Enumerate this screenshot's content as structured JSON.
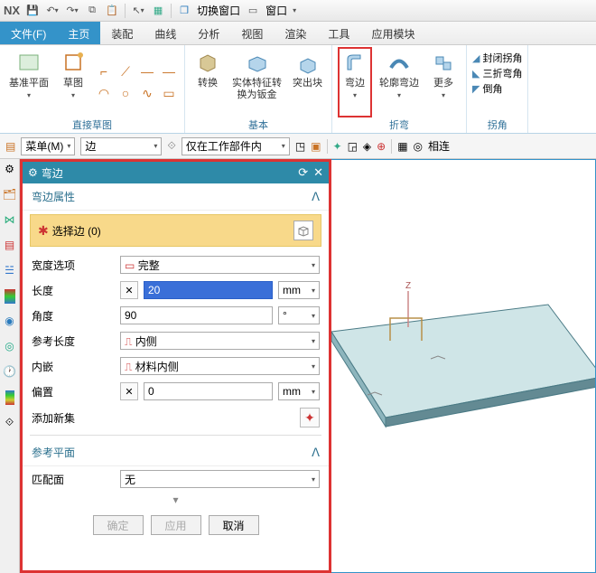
{
  "app": {
    "name": "NX"
  },
  "titlebar": {
    "switchWindow": "切换窗口",
    "window": "窗口"
  },
  "menu": {
    "file": "文件(F)",
    "home": "主页",
    "assembly": "装配",
    "curve": "曲线",
    "analysis": "分析",
    "view": "视图",
    "render": "渲染",
    "tool": "工具",
    "appModule": "应用模块"
  },
  "ribbon": {
    "basePlane": "基准平面",
    "sketch": "草图",
    "directSketch": "直接草图",
    "convert": "转换",
    "solidFeatureToSheet": "实体特征转\n换为钣金",
    "extrude": "突出块",
    "bendEdge": "弯边",
    "contourBend": "轮廓弯边",
    "more": "更多",
    "closedCorner": "封闭拐角",
    "threeBendCorner": "三折弯角",
    "chamfer": "倒角",
    "groupBase": "基本",
    "groupBend": "折弯",
    "groupCorner": "拐角"
  },
  "toolbar2": {
    "menu": "菜单(M)",
    "edge": "边",
    "workPartOnly": "仅在工作部件内",
    "neighbor": "相连"
  },
  "dialog": {
    "title": "弯边",
    "sectionProps": "弯边属性",
    "selectEdge": "选择边 (0)",
    "widthOption": "宽度选项",
    "widthValue": "完整",
    "length": "长度",
    "lengthValue": "20",
    "angle": "角度",
    "angleValue": "90",
    "refLength": "参考长度",
    "refLengthValue": "内侧",
    "inset": "内嵌",
    "insetValue": "材料内侧",
    "offset": "偏置",
    "offsetValue": "0",
    "unitMm": "mm",
    "unitDeg": "°",
    "addSet": "添加新集",
    "refPlane": "参考平面",
    "matchFace": "匹配面",
    "matchFaceValue": "无",
    "ok": "确定",
    "apply": "应用",
    "cancel": "取消"
  }
}
